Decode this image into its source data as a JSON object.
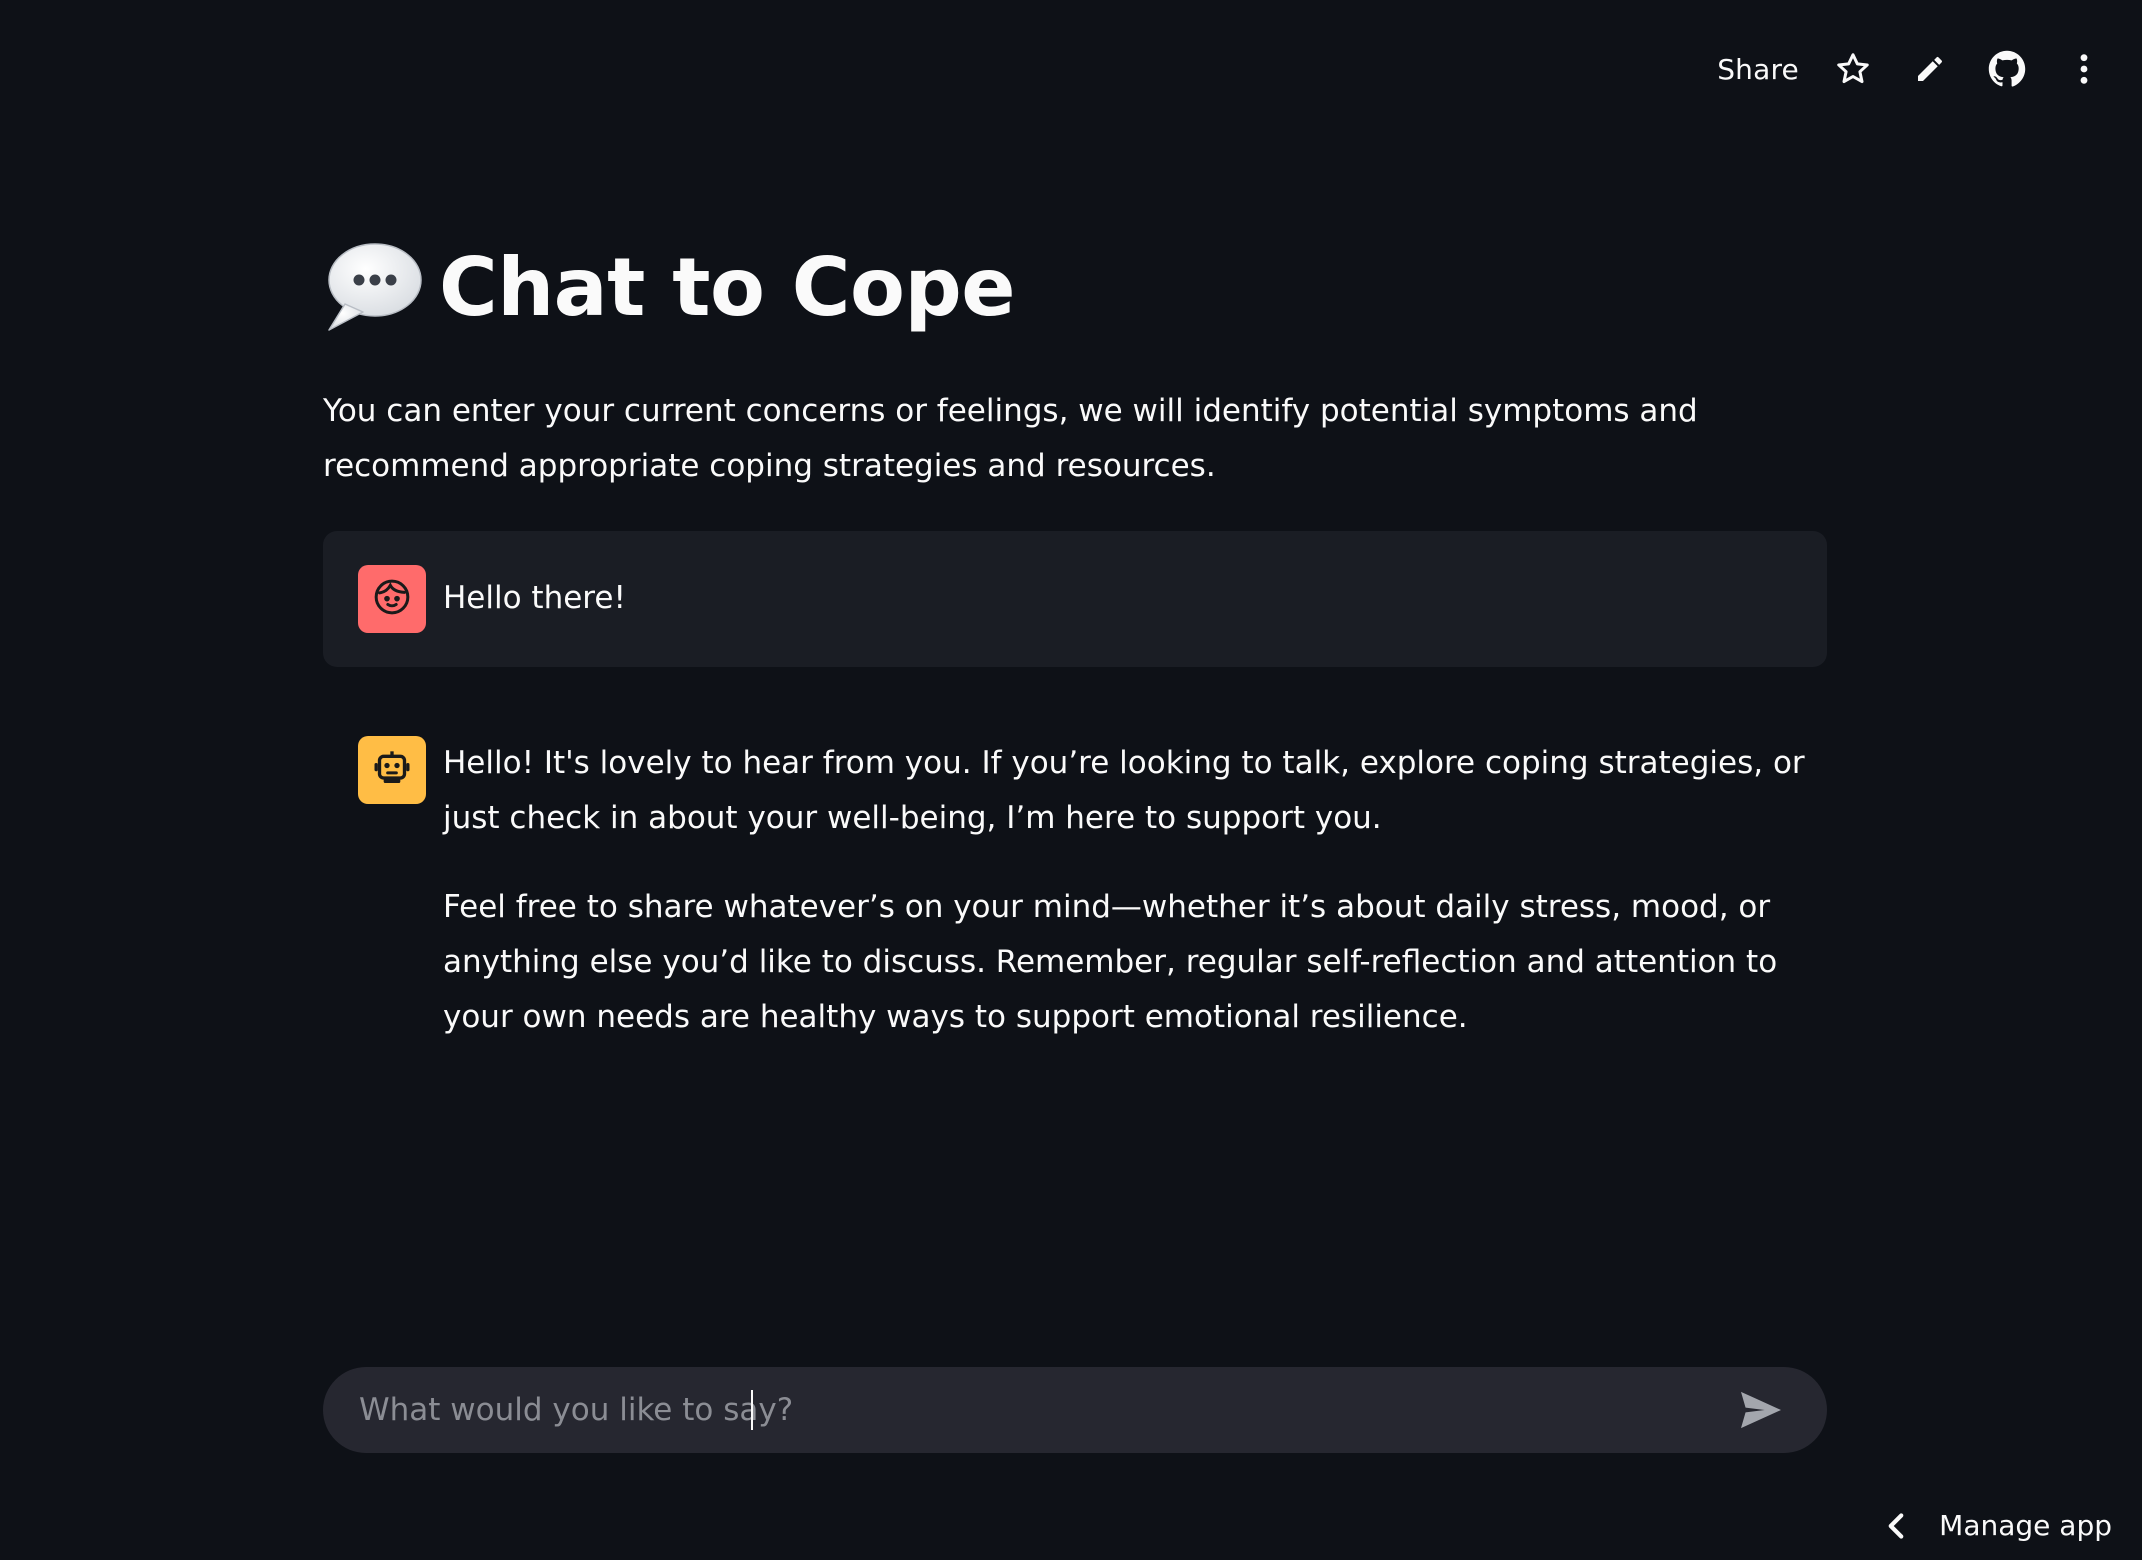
{
  "toolbar": {
    "share_label": "Share",
    "icons": [
      "star-icon",
      "pencil-icon",
      "github-icon",
      "more-vertical-icon"
    ]
  },
  "page": {
    "title_emoji": "speech-bubble-icon",
    "title": "Chat to Cope",
    "subtitle": "You can enter your current concerns or feelings, we will identify potential symptoms and recommend appropriate coping strategies and resources."
  },
  "messages": [
    {
      "role": "user",
      "avatar": "face-icon",
      "avatar_color": "#ff6b6b",
      "paragraphs": [
        "Hello there!"
      ]
    },
    {
      "role": "assistant",
      "avatar": "robot-icon",
      "avatar_color": "#ffbd45",
      "paragraphs": [
        "Hello! It's lovely to hear from you. If you’re looking to talk, explore coping strategies, or just check in about your well-being, I’m here to support you.",
        "Feel free to share whatever’s on your mind—whether it’s about daily stress, mood, or anything else you’d like to discuss. Remember, regular self-reflection and attention to your own needs are healthy ways to support emotional resilience."
      ]
    }
  ],
  "chat_input": {
    "placeholder": "What would you like to say?",
    "value": ""
  },
  "footer": {
    "manage_label": "Manage app"
  },
  "colors": {
    "background": "#0e1117",
    "user_message_bg": "#1a1d24",
    "input_bg": "#262730",
    "text": "#fafafa"
  }
}
